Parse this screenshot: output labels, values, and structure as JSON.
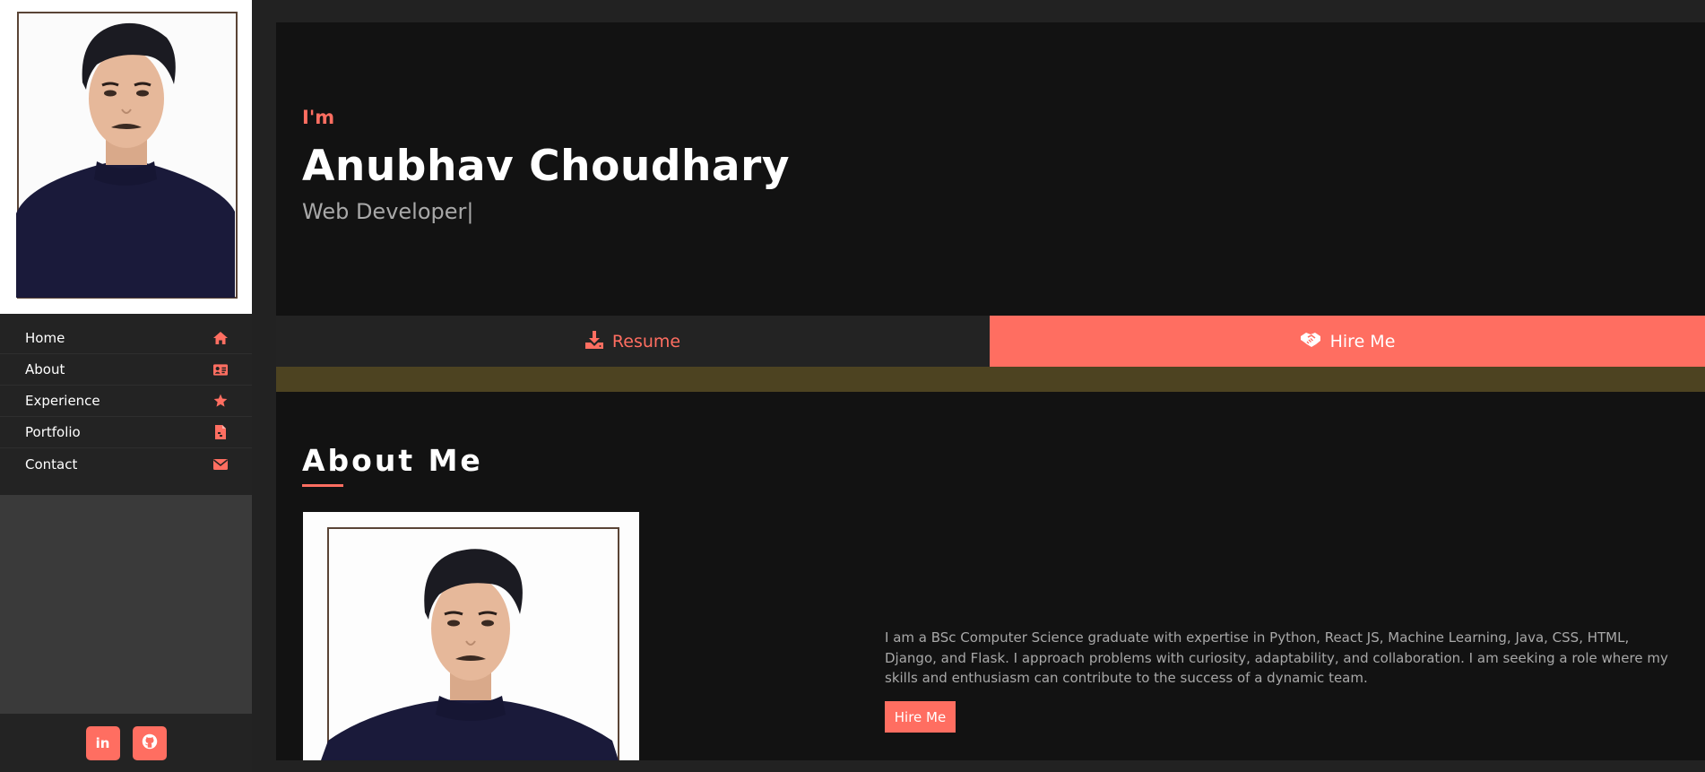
{
  "sidebar": {
    "nav": [
      {
        "label": "Home",
        "icon": "home-icon"
      },
      {
        "label": "About",
        "icon": "id-card-icon"
      },
      {
        "label": "Experience",
        "icon": "star-icon"
      },
      {
        "label": "Portfolio",
        "icon": "file-icon"
      },
      {
        "label": "Contact",
        "icon": "envelope-icon"
      }
    ],
    "social": [
      {
        "icon": "linkedin-icon",
        "text": "in"
      },
      {
        "icon": "github-icon"
      }
    ]
  },
  "hero": {
    "intro": "I'm",
    "name": "Anubhav Choudhary",
    "role": "Web Developer",
    "cursor": "|"
  },
  "cta": {
    "resume_label": "Resume",
    "hire_label": "Hire Me"
  },
  "about": {
    "title": "About Me",
    "text": "I am a BSc Computer Science graduate with expertise in Python, React JS, Machine Learning, Java, CSS, HTML, Django, and Flask. I approach problems with curiosity, adaptability, and collaboration. I am seeking a role where my skills and enthusiasm can contribute to the success of a dynamic team.",
    "hire_button": "Hire Me"
  },
  "colors": {
    "accent": "#ff6e61",
    "background": "#121212",
    "sidebar_nav": "#232323",
    "strip": "#4d4321"
  }
}
